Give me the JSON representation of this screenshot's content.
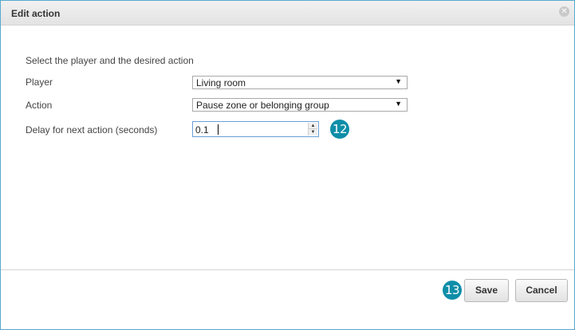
{
  "dialog": {
    "title": "Edit action",
    "close_icon": "close-icon"
  },
  "form": {
    "instruction": "Select the player and the desired action",
    "player": {
      "label": "Player",
      "value": "Living room"
    },
    "action": {
      "label": "Action",
      "value": "Pause zone or belonging group"
    },
    "delay": {
      "label": "Delay for next action (seconds)",
      "value": "0.1"
    }
  },
  "callouts": {
    "delay": "12",
    "save": "13"
  },
  "footer": {
    "save_label": "Save",
    "cancel_label": "Cancel"
  },
  "colors": {
    "accent": "#0e8ea8",
    "border": "#55aacd"
  }
}
